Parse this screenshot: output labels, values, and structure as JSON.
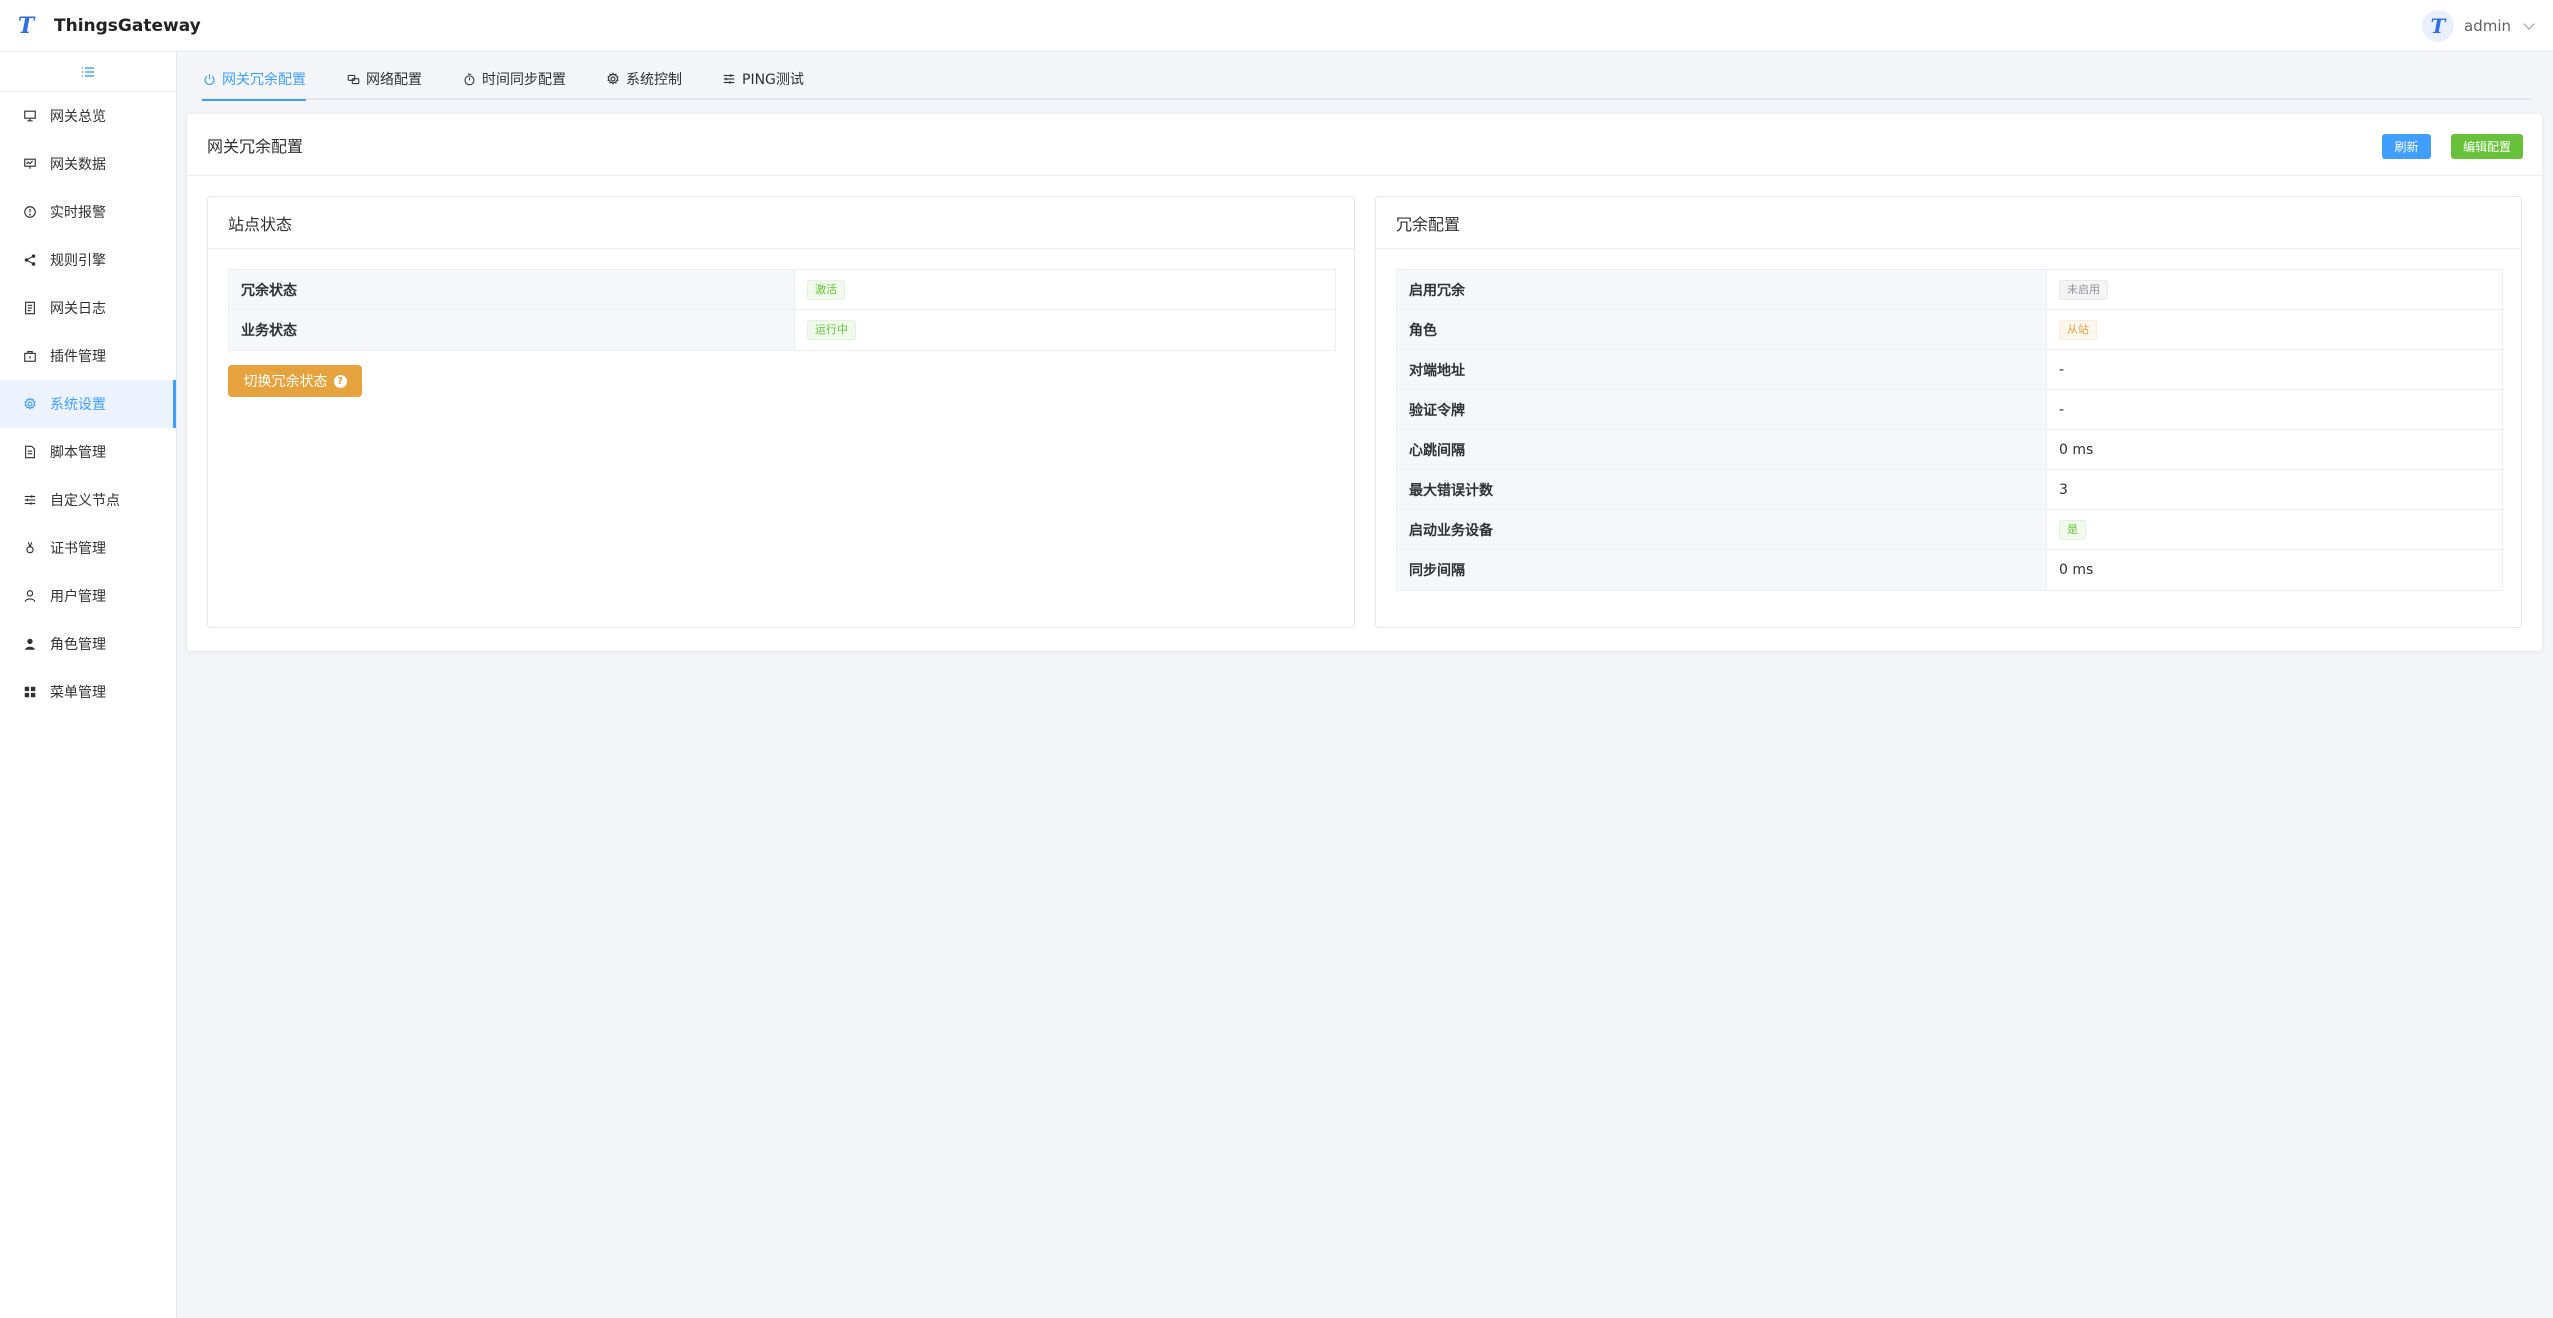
{
  "header": {
    "logo_letter": "T",
    "app_title": "ThingsGateway",
    "avatar_letter": "T",
    "username": "admin"
  },
  "sidebar": {
    "items": [
      {
        "label": "网关总览",
        "icon": "dashboard-icon"
      },
      {
        "label": "网关数据",
        "icon": "data-icon"
      },
      {
        "label": "实时报警",
        "icon": "alarm-icon"
      },
      {
        "label": "规则引擎",
        "icon": "share-icon"
      },
      {
        "label": "网关日志",
        "icon": "log-icon"
      },
      {
        "label": "插件管理",
        "icon": "plugin-icon"
      },
      {
        "label": "系统设置",
        "icon": "gear-icon",
        "active": true
      },
      {
        "label": "脚本管理",
        "icon": "script-icon"
      },
      {
        "label": "自定义节点",
        "icon": "sliders-icon"
      },
      {
        "label": "证书管理",
        "icon": "certificate-icon"
      },
      {
        "label": "用户管理",
        "icon": "user-icon"
      },
      {
        "label": "角色管理",
        "icon": "role-icon"
      },
      {
        "label": "菜单管理",
        "icon": "grid-icon"
      }
    ]
  },
  "tabs": [
    {
      "label": "网关冗余配置",
      "icon": "power-icon",
      "active": true
    },
    {
      "label": "网络配置",
      "icon": "network-icon"
    },
    {
      "label": "时间同步配置",
      "icon": "timer-icon"
    },
    {
      "label": "系统控制",
      "icon": "gear-icon"
    },
    {
      "label": "PING测试",
      "icon": "sliders-icon"
    }
  ],
  "main": {
    "title": "网关冗余配置",
    "refresh_label": "刷新",
    "edit_label": "编辑配置",
    "site_status": {
      "title": "站点状态",
      "rows": [
        {
          "label": "冗余状态",
          "value": "激活",
          "tag": "success"
        },
        {
          "label": "业务状态",
          "value": "运行中",
          "tag": "success"
        }
      ],
      "switch_label": "切换冗余状态"
    },
    "redundancy": {
      "title": "冗余配置",
      "rows": [
        {
          "label": "启用冗余",
          "value": "未启用",
          "tag": "info"
        },
        {
          "label": "角色",
          "value": "从站",
          "tag": "warning"
        },
        {
          "label": "对端地址",
          "value": "-"
        },
        {
          "label": "验证令牌",
          "value": "-"
        },
        {
          "label": "心跳间隔",
          "value": "0 ms"
        },
        {
          "label": "最大错误计数",
          "value": "3"
        },
        {
          "label": "启动业务设备",
          "value": "是",
          "tag": "success"
        },
        {
          "label": "同步间隔",
          "value": "0 ms"
        }
      ]
    }
  },
  "colors": {
    "primary": "#409eff",
    "success": "#67c23a",
    "warning": "#e6a23c",
    "brand": "#2f6fe4"
  }
}
